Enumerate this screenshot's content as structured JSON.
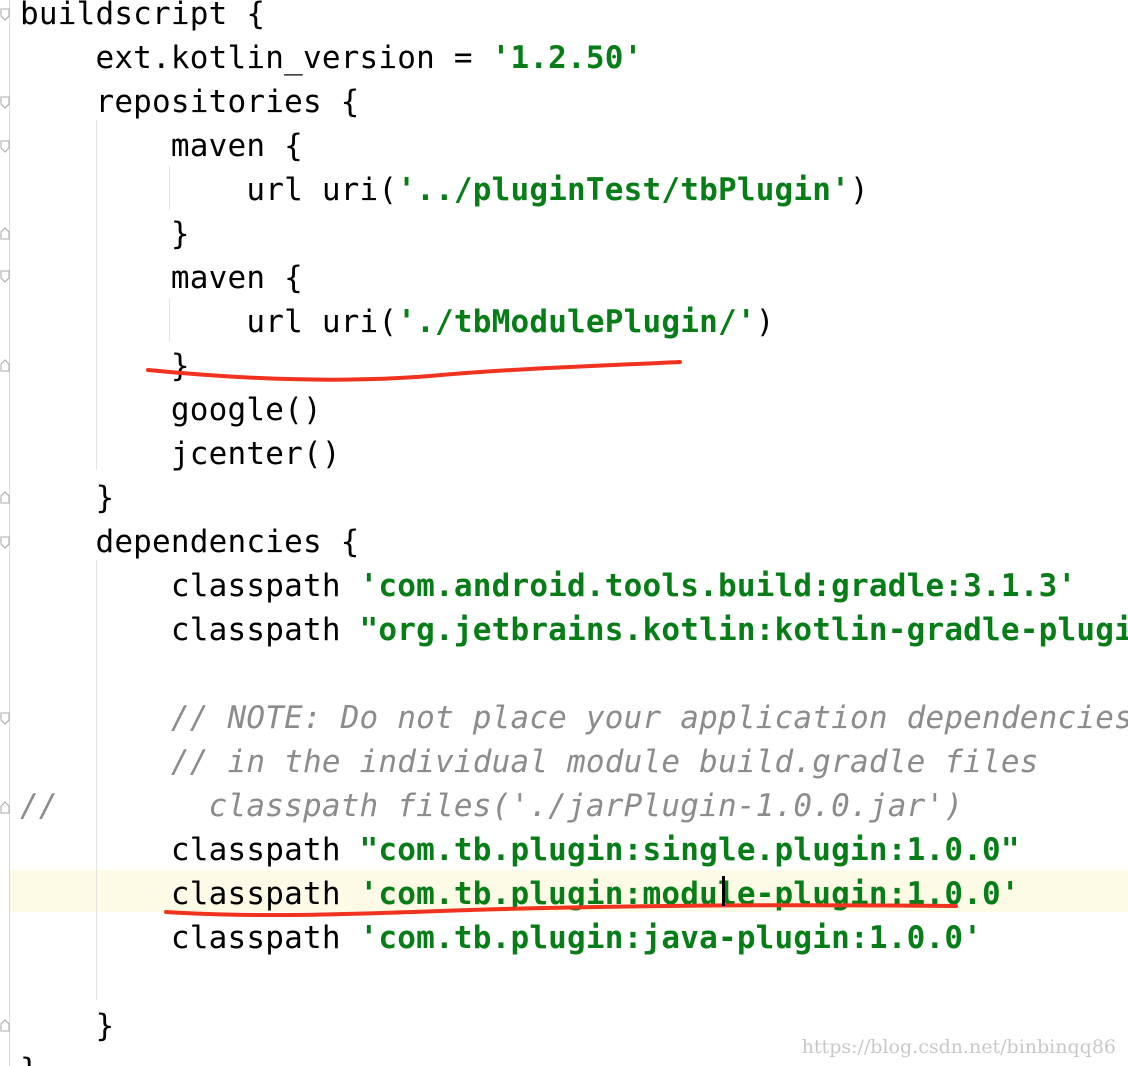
{
  "editor": {
    "lines": {
      "l01": {
        "text": "buildscript {"
      },
      "l02": {
        "pre": "    ext.kotlin_version = ",
        "str": "'1.2.50'"
      },
      "l03": {
        "text": "    repositories {"
      },
      "l04": {
        "text": "        maven {"
      },
      "l05": {
        "pre": "            url uri(",
        "str": "'../pluginTest/tbPlugin'",
        "post": ")"
      },
      "l06": {
        "text": "        }"
      },
      "l07": {
        "text": "        maven {"
      },
      "l08": {
        "pre": "            url uri(",
        "str": "'./tbModulePlugin/'",
        "post": ")"
      },
      "l09": {
        "text": "        }"
      },
      "l10": {
        "text": "        google()"
      },
      "l11": {
        "text": "        jcenter()"
      },
      "l12": {
        "text": "    }"
      },
      "l13": {
        "text": "    dependencies {"
      },
      "l14": {
        "pre": "        classpath ",
        "str": "'com.android.tools.build:gradle:3.1.3'"
      },
      "l15": {
        "pre": "        classpath ",
        "str": "\"org.jetbrains.kotlin:kotlin-gradle-plugin:$"
      },
      "l16": {
        "cmt": "        // NOTE: Do not place your application dependencies he"
      },
      "l17": {
        "cmt": "        // in the individual module build.gradle files"
      },
      "l18": {
        "cmt": "//        classpath files('./jarPlugin-1.0.0.jar')"
      },
      "l19": {
        "pre": "        classpath ",
        "str": "\"com.tb.plugin:single.plugin:1.0.0\""
      },
      "l20": {
        "pre": "        classpath ",
        "str": "'com.tb.plugin:module-plugin:1.0.0'"
      },
      "l21": {
        "pre": "        classpath ",
        "str": "'com.tb.plugin:java-plugin:1.0.0'"
      },
      "l22": {
        "text": "    }"
      },
      "l23": {
        "text": "}"
      }
    }
  },
  "watermark": "https://blog.csdn.net/binbinqq86",
  "colors": {
    "string": "#067d17",
    "comment": "#8c8c8c",
    "current_line": "#fdfbe6",
    "annotation": "#f0321e"
  }
}
